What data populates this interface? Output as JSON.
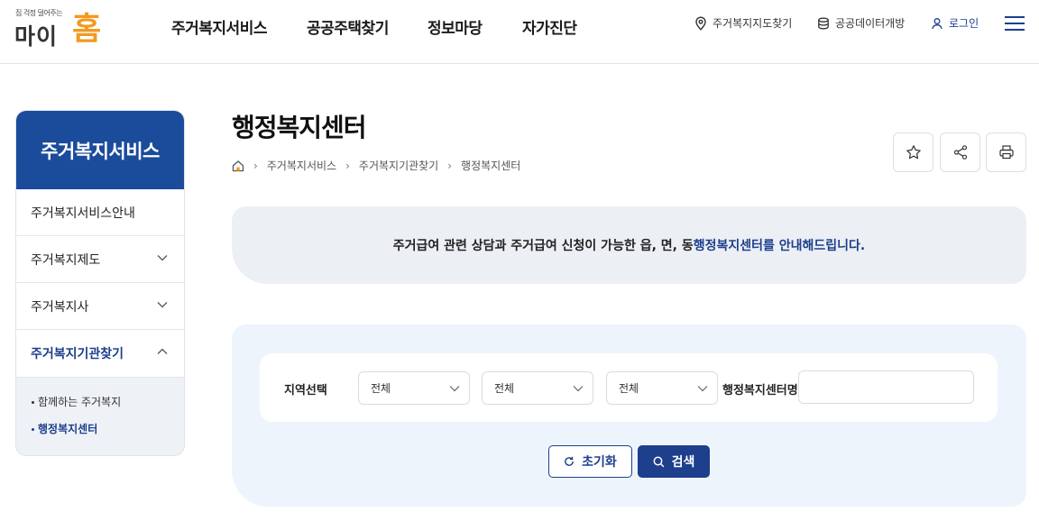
{
  "logo": {
    "tagline": "집 걱정 덜어주는",
    "name_main": "마이",
    "name_accent": "홈"
  },
  "gnb": [
    {
      "label": "주거복지서비스"
    },
    {
      "label": "공공주택찾기"
    },
    {
      "label": "정보마당"
    },
    {
      "label": "자가진단"
    }
  ],
  "utility": {
    "map_label": "주거복지지도찾기",
    "data_label": "공공데이터개방",
    "login_label": "로그인"
  },
  "sidebar": {
    "title": "주거복지서비스",
    "items": [
      {
        "label": "주거복지서비스안내"
      },
      {
        "label": "주거복지제도"
      },
      {
        "label": "주거복지사"
      },
      {
        "label": "주거복지기관찾기"
      }
    ],
    "subitems": [
      {
        "label": "함께하는 주거복지"
      },
      {
        "label": "행정복지센터"
      }
    ]
  },
  "page": {
    "title": "행정복지센터",
    "breadcrumb": [
      "주거복지서비스",
      "주거복지기관찾기",
      "행정복지센터"
    ]
  },
  "notice": {
    "text": "주거급여 관련 상담과 주거급여 신청이 가능한 읍, 면, 동 ",
    "highlight": "행정복지센터를 안내해드립니다."
  },
  "search": {
    "region_label": "지역선택",
    "select1": "전체",
    "select2": "전체",
    "select3": "전체",
    "name_label": "행정복지센터명",
    "name_value": "",
    "reset_label": "초기화",
    "search_label": "검색"
  },
  "colors": {
    "primary": "#1d3f8c",
    "sidebar_header": "#1b4b9b",
    "logo_accent": "#f29a1f"
  }
}
